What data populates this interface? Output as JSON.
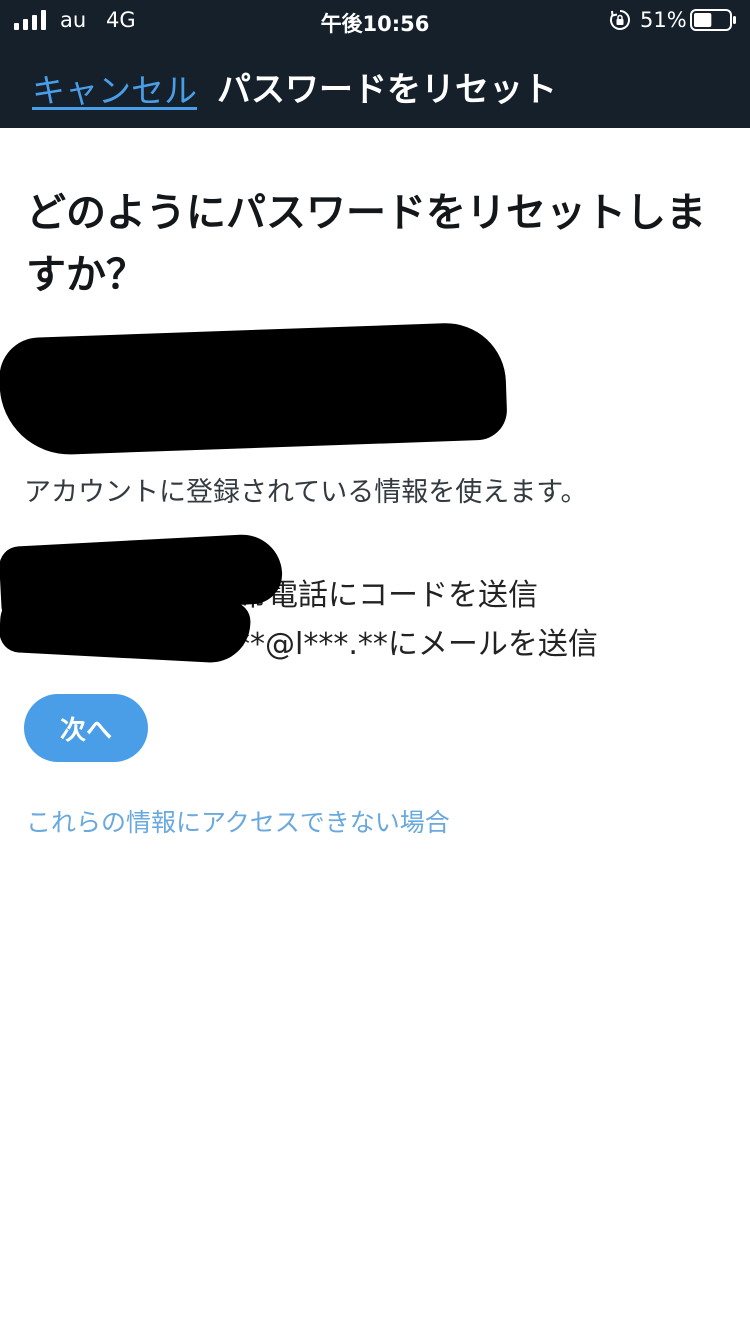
{
  "status_bar": {
    "carrier": "au",
    "network": "4G",
    "time": "午後10:56",
    "battery_percent": "51%",
    "battery_level": 0.51,
    "icons": [
      "signal-icon",
      "orientation-lock-icon",
      "battery-icon"
    ]
  },
  "nav": {
    "cancel_label": "キャンセル",
    "title": "パスワードをリセット"
  },
  "content": {
    "heading": "どのようにパスワードをリセットしますか？",
    "description": "アカウントに登録されている情報を使えます。",
    "options": [
      {
        "text": "携帯電話にコードを送信"
      },
      {
        "text": "**@l***.**にメールを送信"
      }
    ],
    "next_label": "次へ",
    "help_link": "これらの情報にアクセスできない場合"
  },
  "colors": {
    "header_bg": "#15202b",
    "accent": "#4a9ee8",
    "link": "#69a9dd",
    "text": "#14171a"
  }
}
